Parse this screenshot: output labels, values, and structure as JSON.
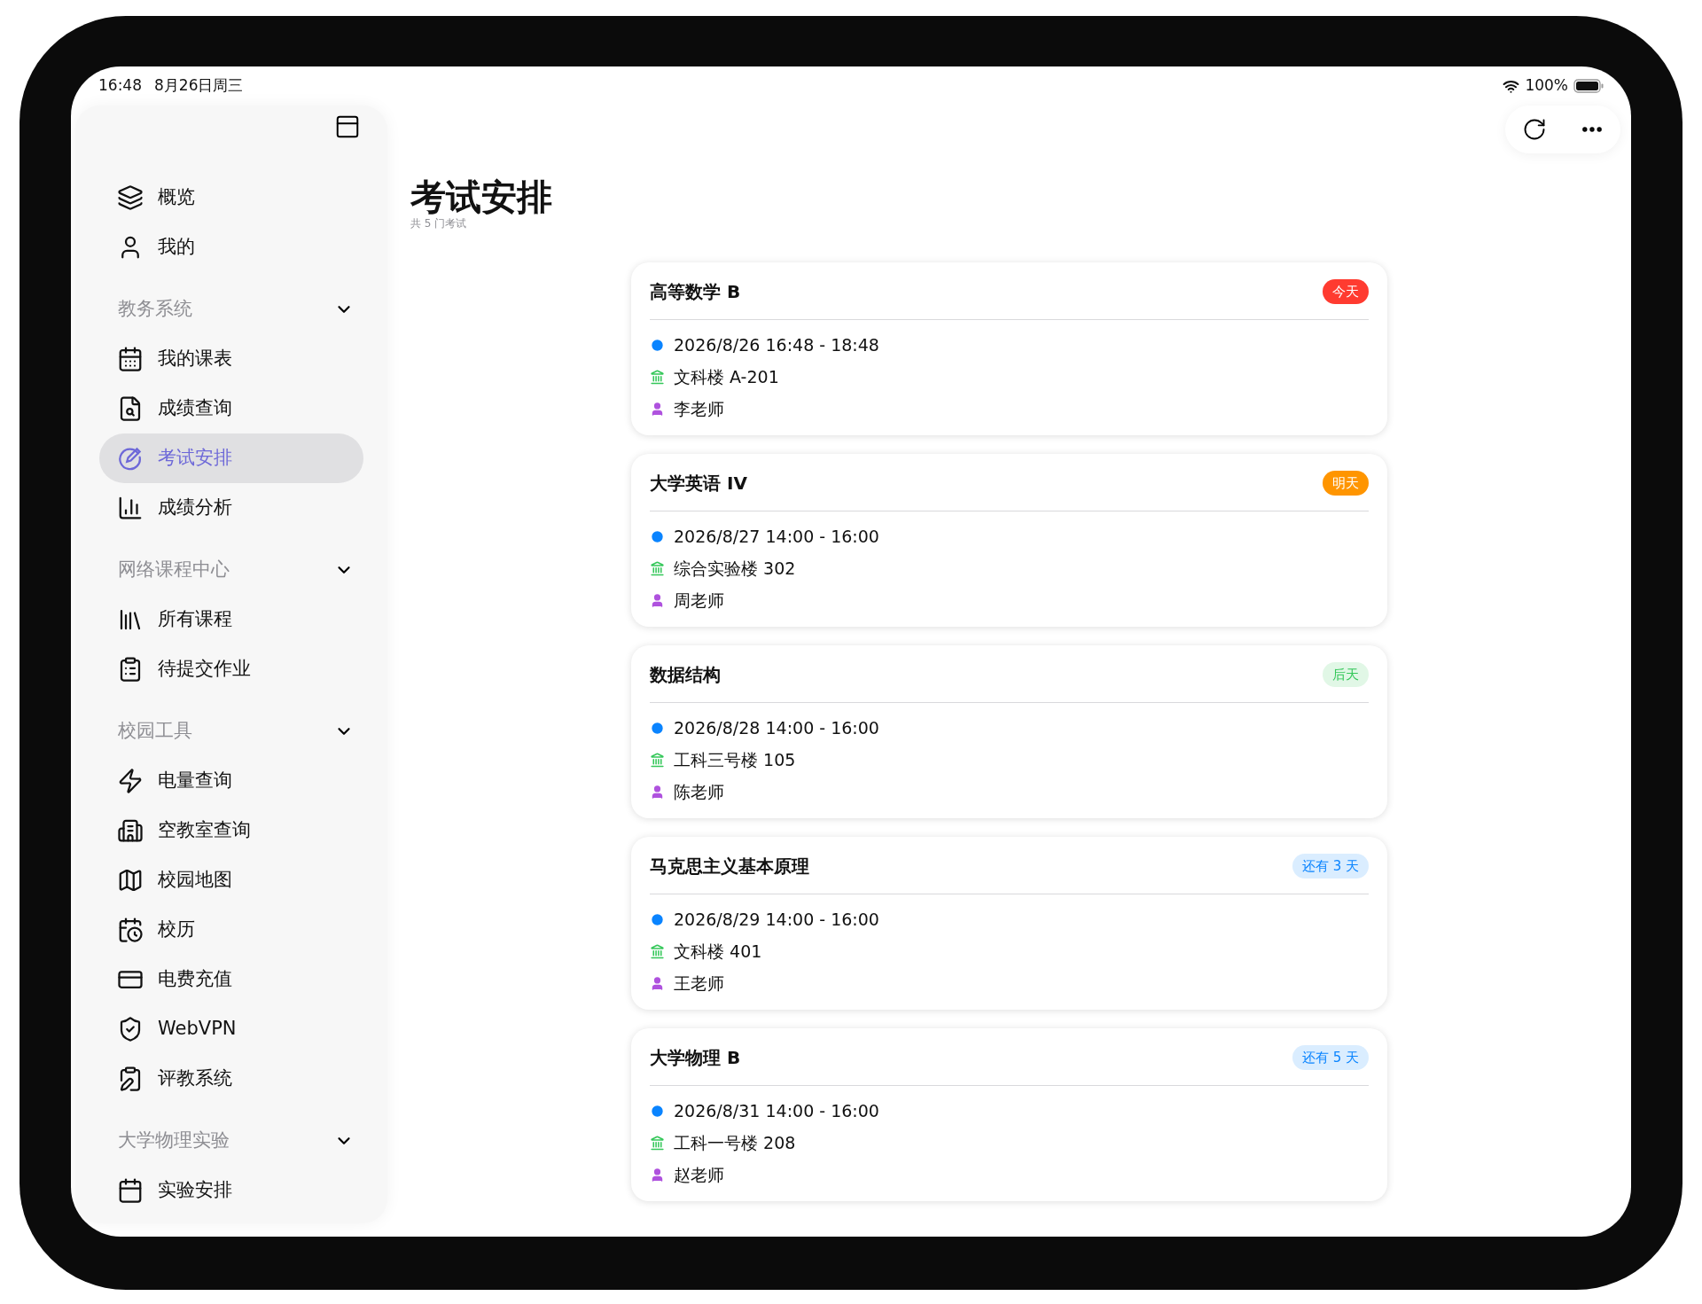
{
  "status_bar": {
    "time": "16:48",
    "date": "8月26日周三",
    "battery": "100%"
  },
  "sidebar": {
    "items": [
      {
        "label": "概览",
        "selected": false
      },
      {
        "label": "我的",
        "selected": false
      }
    ],
    "sections": [
      {
        "title": "教务系统",
        "expanded": true,
        "items": [
          {
            "label": "我的课表",
            "selected": false
          },
          {
            "label": "成绩查询",
            "selected": false
          },
          {
            "label": "考试安排",
            "selected": true
          },
          {
            "label": "成绩分析",
            "selected": false
          }
        ]
      },
      {
        "title": "网络课程中心",
        "expanded": true,
        "items": [
          {
            "label": "所有课程",
            "selected": false
          },
          {
            "label": "待提交作业",
            "selected": false
          }
        ]
      },
      {
        "title": "校园工具",
        "expanded": true,
        "items": [
          {
            "label": "电量查询",
            "selected": false
          },
          {
            "label": "空教室查询",
            "selected": false
          },
          {
            "label": "校园地图",
            "selected": false
          },
          {
            "label": "校历",
            "selected": false
          },
          {
            "label": "电费充值",
            "selected": false
          },
          {
            "label": "WebVPN",
            "selected": false
          },
          {
            "label": "评教系统",
            "selected": false
          }
        ]
      },
      {
        "title": "大学物理实验",
        "expanded": true,
        "items": [
          {
            "label": "实验安排",
            "selected": false
          }
        ]
      }
    ]
  },
  "page": {
    "title": "考试安排",
    "subtitle": "共 5 门考试"
  },
  "exams": [
    {
      "name": "高等数学 B",
      "badge": {
        "text": "今天",
        "kind": "solid",
        "color": "#ff3b30"
      },
      "time": "2026/8/26 16:48 - 18:48",
      "location": "文科楼 A-201",
      "teacher": "李老师"
    },
    {
      "name": "大学英语 IV",
      "badge": {
        "text": "明天",
        "kind": "solid",
        "color": "#ff9500"
      },
      "time": "2026/8/27 14:00 - 16:00",
      "location": "综合实验楼 302",
      "teacher": "周老师"
    },
    {
      "name": "数据结构",
      "badge": {
        "text": "后天",
        "kind": "tint",
        "color": "#34c759"
      },
      "time": "2026/8/28 14:00 - 16:00",
      "location": "工科三号楼 105",
      "teacher": "陈老师"
    },
    {
      "name": "马克思主义基本原理",
      "badge": {
        "text": "还有 3 天",
        "kind": "tint",
        "color": "#0a84ff"
      },
      "time": "2026/8/29 14:00 - 16:00",
      "location": "文科楼 401",
      "teacher": "王老师"
    },
    {
      "name": "大学物理 B",
      "badge": {
        "text": "还有 5 天",
        "kind": "tint",
        "color": "#0a84ff"
      },
      "time": "2026/8/31 14:00 - 16:00",
      "location": "工科一号楼 208",
      "teacher": "赵老师"
    }
  ]
}
